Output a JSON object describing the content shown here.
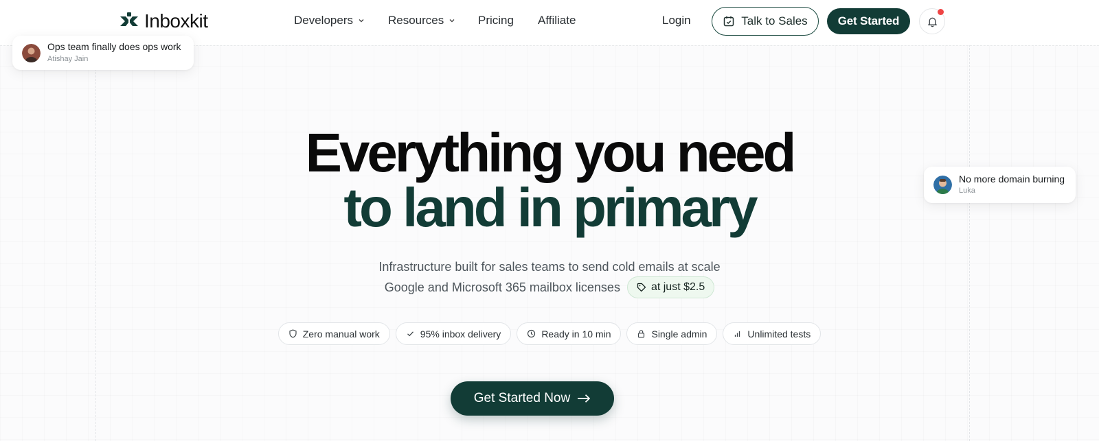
{
  "brand": {
    "name": "Inboxkit",
    "logo_icon": "inboxkit-logo-icon",
    "color": "#123c36"
  },
  "nav": {
    "items": [
      {
        "label": "Developers",
        "has_dropdown": true
      },
      {
        "label": "Resources",
        "has_dropdown": true
      },
      {
        "label": "Pricing",
        "has_dropdown": false
      },
      {
        "label": "Affiliate",
        "has_dropdown": false
      }
    ],
    "login": "Login",
    "talk_to_sales": "Talk to Sales",
    "get_started": "Get Started",
    "notification_icon": "bell-icon",
    "notification_dot_color": "#ef4444"
  },
  "testimonials": [
    {
      "quote": "Ops team finally does ops work",
      "author": "Atishay Jain"
    },
    {
      "quote": "No more domain burning",
      "author": "Luka"
    }
  ],
  "hero": {
    "title_line1": "Everything you need",
    "title_line2": "to land in primary",
    "subtitle_line1": "Infrastructure built for sales teams to send cold emails at scale",
    "subtitle_line2": "Google and Microsoft 365 mailbox licenses",
    "price_badge": "at just $2.5"
  },
  "features": [
    {
      "label": "Zero manual work",
      "icon": "shield-icon"
    },
    {
      "label": "95% inbox delivery",
      "icon": "check-icon"
    },
    {
      "label": "Ready in 10 min",
      "icon": "clock-icon"
    },
    {
      "label": "Single admin",
      "icon": "lock-icon"
    },
    {
      "label": "Unlimited tests",
      "icon": "bar-chart-icon"
    }
  ],
  "cta": {
    "label": "Get Started Now",
    "icon": "arrow-right-icon"
  }
}
